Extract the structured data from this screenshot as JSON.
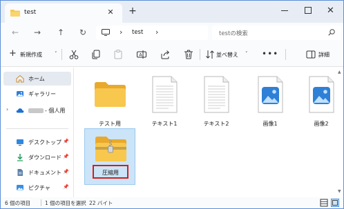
{
  "window": {
    "tab_title": "test",
    "tab_close_glyph": "✕",
    "new_tab_glyph": "+",
    "minimize_icon": "minimize-icon",
    "maximize_icon": "maximize-icon",
    "close_glyph": "✕"
  },
  "address": {
    "back_glyph": "←",
    "forward_glyph": "→",
    "up_glyph": "↑",
    "refresh_glyph": "↻",
    "separator_glyph": "›",
    "location": "test",
    "search_placeholder": "testの検索"
  },
  "commandbar": {
    "new_label": "新規作成",
    "new_glyph": "+",
    "chevron_glyph": "˅",
    "sort_label": "並べ替え",
    "more_glyph": "•••",
    "details_label": "詳細"
  },
  "sidebar": {
    "expand_glyph": "›",
    "pin_glyph": "📌",
    "items": [
      {
        "label": "ホーム"
      },
      {
        "label": "ギャラリー"
      },
      {
        "label": "- 個人用"
      },
      {
        "label": "デスクトップ"
      },
      {
        "label": "ダウンロード"
      },
      {
        "label": "ドキュメント"
      },
      {
        "label": "ピクチャ"
      }
    ]
  },
  "files": [
    {
      "name": "テスト用",
      "type": "folder"
    },
    {
      "name": "テキスト1",
      "type": "text"
    },
    {
      "name": "テキスト2",
      "type": "text"
    },
    {
      "name": "画像1",
      "type": "image"
    },
    {
      "name": "画像2",
      "type": "image"
    },
    {
      "name": "圧縮用",
      "type": "zip-folder"
    }
  ],
  "status": {
    "item_count": "6 個の項目",
    "selection": "1 個の項目を選択",
    "size": "22 バイト"
  },
  "scrollbar": {
    "up_glyph": "▲",
    "down_glyph": "▼"
  },
  "colors": {
    "accent": "#0067c0",
    "folder": "#f8c74e",
    "selection_bg": "#cce4f7",
    "highlight_box": "#d81b1b"
  }
}
